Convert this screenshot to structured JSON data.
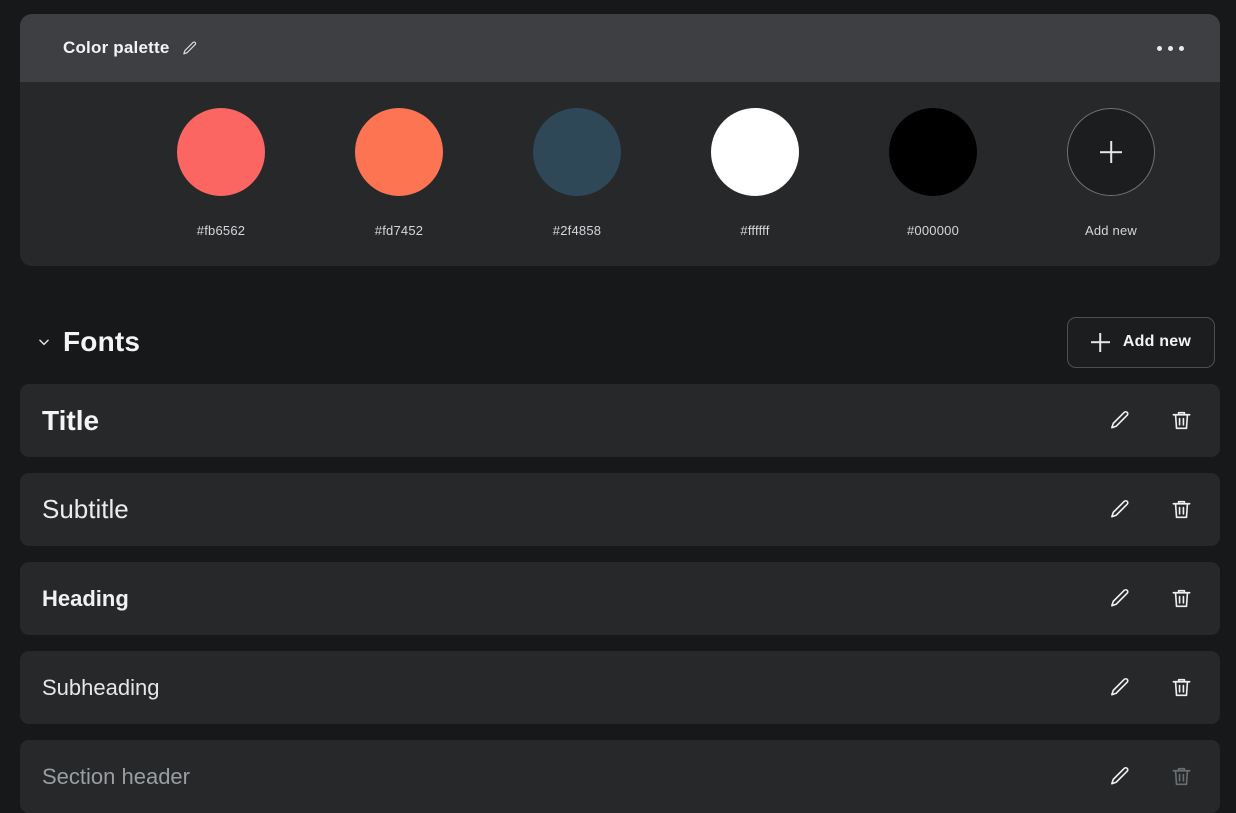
{
  "palette_card": {
    "title": "Color palette",
    "edit_icon": "pencil-icon",
    "menu_icon": "more-options-icon",
    "swatches": [
      {
        "label": "#fb6562",
        "color": "#fb6562",
        "type": "color"
      },
      {
        "label": "#fd7452",
        "color": "#fd7452",
        "type": "color"
      },
      {
        "label": "#2f4858",
        "color": "#2f4858",
        "type": "color"
      },
      {
        "label": "#ffffff",
        "color": "#ffffff",
        "type": "color"
      },
      {
        "label": "#000000",
        "color": "#000000",
        "type": "color"
      },
      {
        "label": "Add new",
        "color": "#1b1d1f",
        "type": "add"
      }
    ]
  },
  "fonts_section": {
    "title": "Fonts",
    "collapse_icon": "chevron-down-icon",
    "add_new_label": "Add new",
    "add_new_icon": "plus-icon",
    "rows": [
      {
        "label": "Title",
        "size": "28px",
        "weight": "bold",
        "color": "#f3f4f5",
        "delete_enabled": true
      },
      {
        "label": "Subtitle",
        "size": "26px",
        "weight": "normal",
        "color": "#e9ebed",
        "delete_enabled": true
      },
      {
        "label": "Heading",
        "size": "22px",
        "weight": "bold",
        "color": "#f0f1f2",
        "delete_enabled": true
      },
      {
        "label": "Subheading",
        "size": "22px",
        "weight": "normal",
        "color": "#e4e6e8",
        "delete_enabled": true
      },
      {
        "label": "Section header",
        "size": "22px",
        "weight": "normal",
        "color": "#9a9ea1",
        "delete_enabled": false
      }
    ],
    "edit_icon": "pencil-icon",
    "delete_icon": "trash-icon"
  },
  "colors": {
    "page_bg": "#16181a",
    "card_bg": "#26282a",
    "card_header_bg": "#3d3f42",
    "border": "#4d5053",
    "text_primary": "#f2f3f4",
    "text_muted": "#9a9ea1"
  }
}
